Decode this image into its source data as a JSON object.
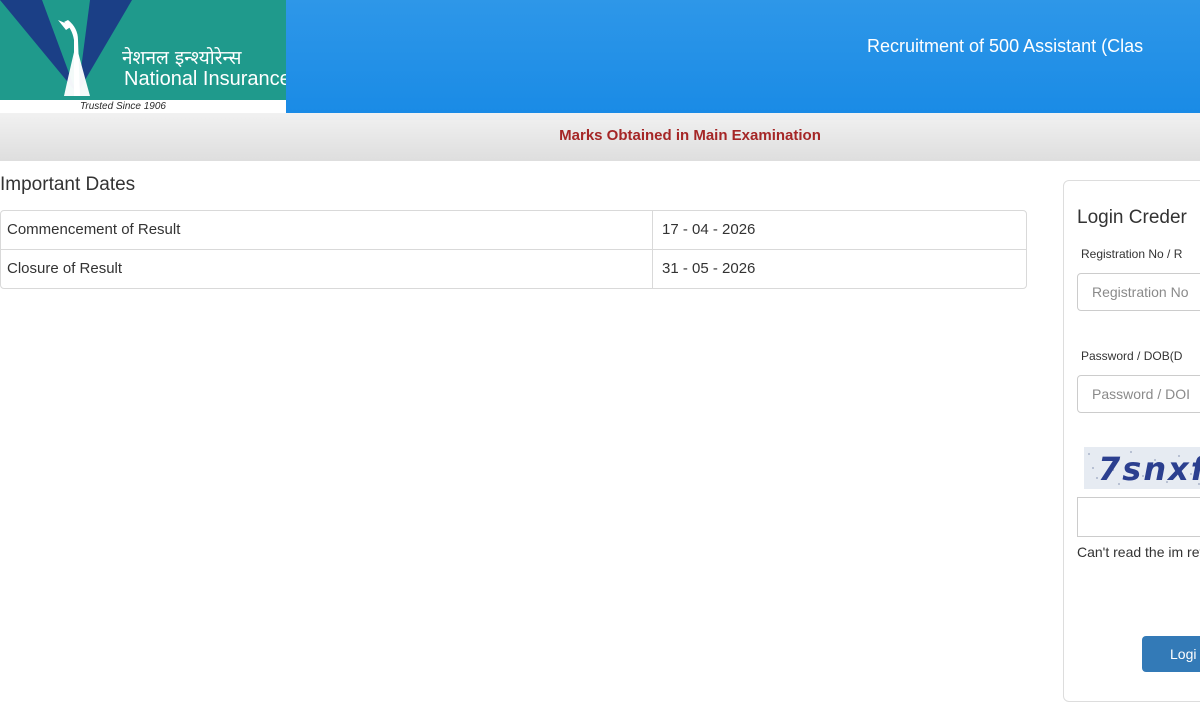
{
  "header": {
    "logo": {
      "hindi_name": "नेशनल इन्श्योरेन्स",
      "english_name": "National Insurance",
      "tagline": "Trusted Since 1906"
    },
    "title": "Recruitment of 500 Assistant (Clas"
  },
  "subheader": {
    "link_text": "Marks Obtained in Main Examination"
  },
  "important_dates": {
    "heading": "Important Dates",
    "rows": [
      {
        "label": "Commencement of Result",
        "value": "17 - 04 - 2026"
      },
      {
        "label": "Closure of Result",
        "value": "31 - 05 - 2026"
      }
    ]
  },
  "login": {
    "heading": "Login Creder",
    "registration_label": "Registration No / R",
    "registration_placeholder": "Registration No",
    "password_label": "Password / DOB(D",
    "password_placeholder": "Password / DOI",
    "captcha_text": "7snxf",
    "captcha_input_value": "",
    "captcha_help": "Can't read the im refresh.",
    "button_label": "Logi"
  },
  "colors": {
    "header_blue": "#1a8be6",
    "logo_green": "#1f9a8c",
    "subheader_text": "#a52626",
    "button_blue": "#337ab7"
  }
}
